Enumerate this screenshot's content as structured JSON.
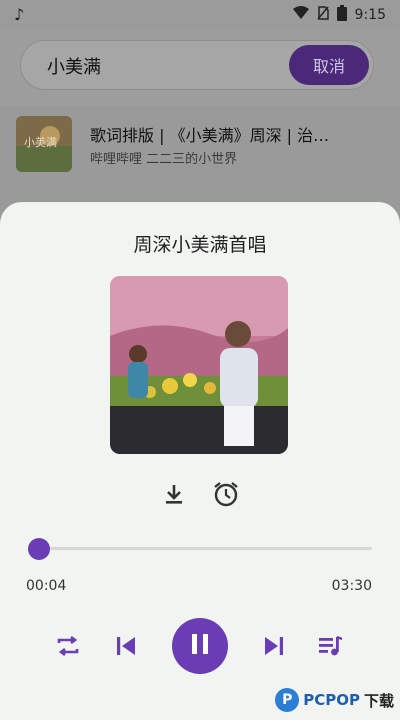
{
  "status_bar": {
    "time": "9:15"
  },
  "search": {
    "query": "小美满",
    "cancel_label": "取消"
  },
  "results": [
    {
      "title": "歌词排版 | 《小美满》周深 | 治…",
      "subtitle": "哔哩哔哩  二二三的小世界"
    }
  ],
  "player": {
    "title": "周深小美满首唱",
    "current_time": "00:04",
    "total_time": "03:30",
    "progress_fraction": 0.02
  },
  "watermark": {
    "brand": "PCPOP",
    "suffix": "下载"
  },
  "icons": {
    "status": [
      "music-note-icon",
      "wifi-icon",
      "no-sim-icon",
      "battery-icon"
    ],
    "player_actions": [
      "download-icon",
      "alarm-icon"
    ],
    "controls": [
      "repeat-icon",
      "previous-icon",
      "pause-icon",
      "next-icon",
      "playlist-icon"
    ]
  },
  "colors": {
    "accent": "#6a3db5",
    "sheet_bg": "#f2f4f2",
    "overlay": "#9b9b9b"
  }
}
